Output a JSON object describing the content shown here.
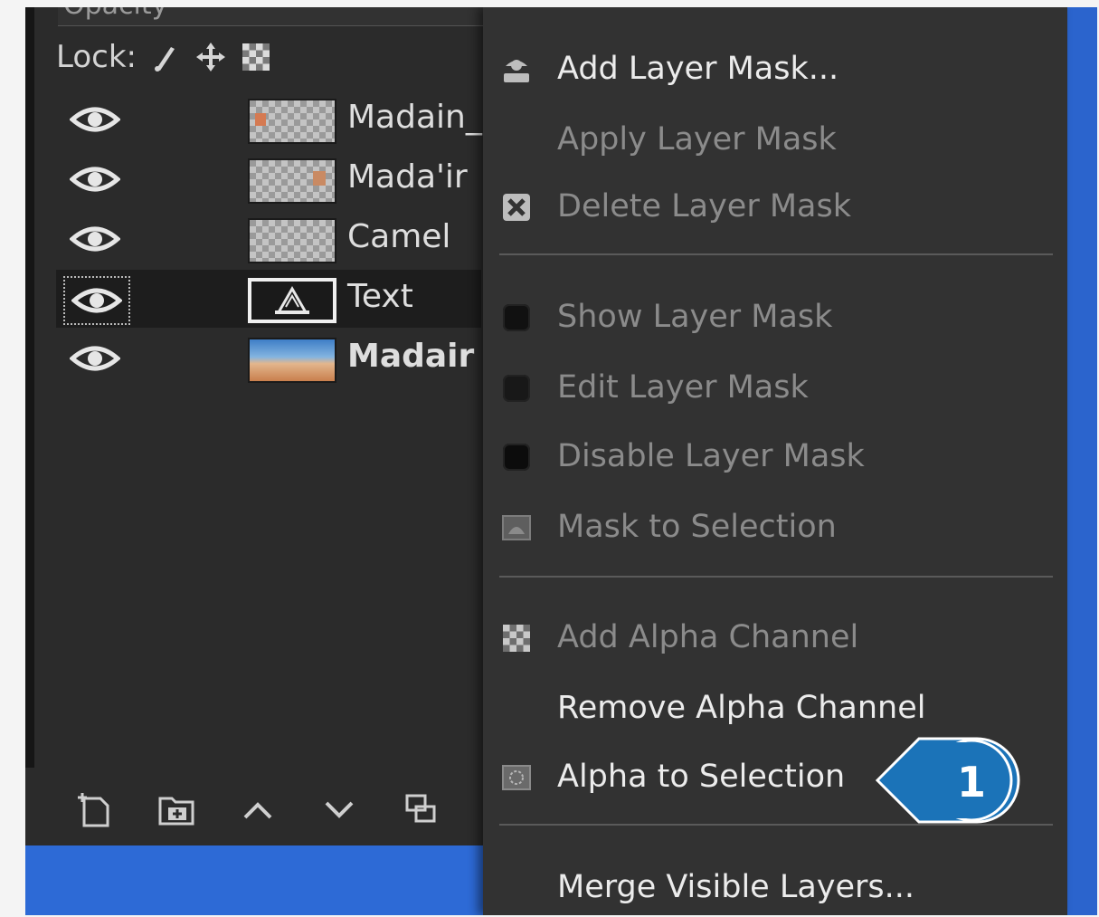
{
  "layers_panel": {
    "opacity_label": "Opacity",
    "lock_label": "Lock:",
    "lock_icons": [
      "paintbrush-icon",
      "move-icon",
      "alpha-checker-icon"
    ],
    "layers": [
      {
        "name": "Madain_",
        "visible": true,
        "thumb": "transparent"
      },
      {
        "name": "Mada'ir",
        "visible": true,
        "thumb": "transparent"
      },
      {
        "name": "Camel",
        "visible": true,
        "thumb": "transparent"
      },
      {
        "name": "Text",
        "visible": true,
        "thumb": "text",
        "selected": true
      },
      {
        "name": "Madair",
        "visible": true,
        "thumb": "desert"
      }
    ],
    "toolbar_icons": [
      "new-layer-icon",
      "new-layer-group-icon",
      "raise-layer-icon",
      "lower-layer-icon",
      "duplicate-layer-icon"
    ]
  },
  "context_menu": {
    "items": [
      {
        "label": "Add Layer Mask...",
        "enabled": true,
        "icon": "layer-mask-icon"
      },
      {
        "label": "Apply Layer Mask",
        "enabled": false,
        "icon": ""
      },
      {
        "label": "Delete Layer Mask",
        "enabled": false,
        "icon": "delete-icon"
      },
      {
        "label": "Show Layer Mask",
        "enabled": false,
        "icon": "checkbox-icon"
      },
      {
        "label": "Edit Layer Mask",
        "enabled": false,
        "icon": "checkbox-icon"
      },
      {
        "label": "Disable Layer Mask",
        "enabled": false,
        "icon": "checkbox-icon"
      },
      {
        "label": "Mask to Selection",
        "enabled": false,
        "icon": "mask-selection-icon"
      },
      {
        "label": "Add Alpha Channel",
        "enabled": false,
        "icon": "alpha-checker-icon"
      },
      {
        "label": "Remove Alpha Channel",
        "enabled": true,
        "icon": ""
      },
      {
        "label": "Alpha to Selection",
        "enabled": true,
        "icon": "alpha-selection-icon"
      },
      {
        "label": "Merge Visible Layers...",
        "enabled": true,
        "icon": ""
      }
    ]
  },
  "callout": {
    "number": "1",
    "color": "#1b73b8"
  },
  "colors": {
    "panel_bg": "#2b2b2b",
    "menu_bg": "#323232",
    "accent_blue": "#2d6ad6"
  }
}
